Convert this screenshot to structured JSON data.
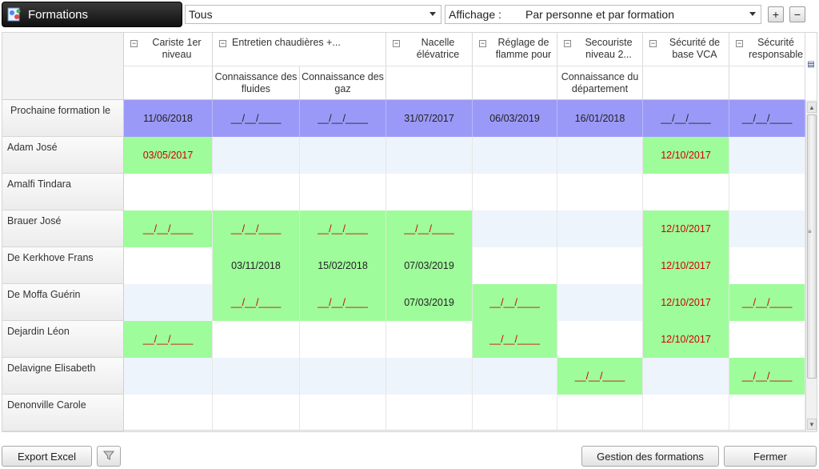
{
  "header": {
    "title": "Formations",
    "filter_value": "Tous",
    "view_label": "Affichage :",
    "view_value": "Par personne et par formation",
    "expand_label": "+",
    "collapse_label": "−"
  },
  "columns": [
    {
      "group": "Cariste 1er niveau",
      "sub": ""
    },
    {
      "group": "Entretien chaudières +...",
      "sub": "Connaissance des fluides"
    },
    {
      "group": "",
      "sub": "Connaissance des gaz"
    },
    {
      "group": "Nacelle élévatrice",
      "sub": ""
    },
    {
      "group": "Réglage de flamme pour",
      "sub": ""
    },
    {
      "group": "Secouriste niveau 2...",
      "sub": "Connaissance du département"
    },
    {
      "group": "Sécurité de base VCA",
      "sub": ""
    },
    {
      "group": "Sécurité responsable",
      "sub": ""
    }
  ],
  "next_training": {
    "label": "Prochaine formation le",
    "values": [
      "11/06/2018",
      "__/__/____",
      "__/__/____",
      "31/07/2017",
      "06/03/2019",
      "16/01/2018",
      "__/__/____",
      "__/__/____"
    ]
  },
  "rows": [
    {
      "name": "Adam José",
      "cells": [
        [
          "green",
          "03/05/2017",
          "red"
        ],
        [
          "alt",
          "",
          ""
        ],
        [
          "alt",
          "",
          ""
        ],
        [
          "alt",
          "",
          ""
        ],
        [
          "alt",
          "",
          ""
        ],
        [
          "alt",
          "",
          ""
        ],
        [
          "green",
          "12/10/2017",
          "red"
        ],
        [
          "alt",
          "",
          ""
        ]
      ]
    },
    {
      "name": "Amalfi Tindara",
      "cells": [
        [
          "white",
          "",
          ""
        ],
        [
          "white",
          "",
          ""
        ],
        [
          "white",
          "",
          ""
        ],
        [
          "white",
          "",
          ""
        ],
        [
          "white",
          "",
          ""
        ],
        [
          "white",
          "",
          ""
        ],
        [
          "white",
          "",
          ""
        ],
        [
          "white",
          "",
          ""
        ]
      ]
    },
    {
      "name": "Brauer José",
      "cells": [
        [
          "green",
          "__/__/____",
          "red"
        ],
        [
          "green",
          "__/__/____",
          "red"
        ],
        [
          "green",
          "__/__/____",
          "red"
        ],
        [
          "green",
          "__/__/____",
          "red"
        ],
        [
          "alt",
          "",
          ""
        ],
        [
          "alt",
          "",
          ""
        ],
        [
          "green",
          "12/10/2017",
          "red"
        ],
        [
          "alt",
          "",
          ""
        ]
      ]
    },
    {
      "name": "De Kerkhove Frans",
      "cells": [
        [
          "white",
          "",
          ""
        ],
        [
          "green",
          "03/11/2018",
          "dark"
        ],
        [
          "green",
          "15/02/2018",
          "dark"
        ],
        [
          "green",
          "07/03/2019",
          "dark"
        ],
        [
          "white",
          "",
          ""
        ],
        [
          "white",
          "",
          ""
        ],
        [
          "green",
          "12/10/2017",
          "red"
        ],
        [
          "white",
          "",
          ""
        ]
      ]
    },
    {
      "name": "De Moffa Guérin",
      "cells": [
        [
          "alt",
          "",
          ""
        ],
        [
          "green",
          "__/__/____",
          "red"
        ],
        [
          "green",
          "__/__/____",
          "red"
        ],
        [
          "green",
          "07/03/2019",
          "dark"
        ],
        [
          "green",
          "__/__/____",
          "red"
        ],
        [
          "alt",
          "",
          ""
        ],
        [
          "green",
          "12/10/2017",
          "red"
        ],
        [
          "green",
          "__/__/____",
          "red"
        ]
      ]
    },
    {
      "name": "Dejardin Léon",
      "cells": [
        [
          "green",
          "__/__/____",
          "red"
        ],
        [
          "white",
          "",
          ""
        ],
        [
          "white",
          "",
          ""
        ],
        [
          "white",
          "",
          ""
        ],
        [
          "green",
          "__/__/____",
          "red"
        ],
        [
          "white",
          "",
          ""
        ],
        [
          "green",
          "12/10/2017",
          "red"
        ],
        [
          "white",
          "",
          ""
        ]
      ]
    },
    {
      "name": "Delavigne Elisabeth",
      "cells": [
        [
          "alt",
          "",
          ""
        ],
        [
          "alt",
          "",
          ""
        ],
        [
          "alt",
          "",
          ""
        ],
        [
          "alt",
          "",
          ""
        ],
        [
          "alt",
          "",
          ""
        ],
        [
          "green",
          "__/__/____",
          "red"
        ],
        [
          "alt",
          "",
          ""
        ],
        [
          "green",
          "__/__/____",
          "red"
        ]
      ]
    },
    {
      "name": "Denonville Carole",
      "cells": [
        [
          "white",
          "",
          ""
        ],
        [
          "white",
          "",
          ""
        ],
        [
          "white",
          "",
          ""
        ],
        [
          "white",
          "",
          ""
        ],
        [
          "white",
          "",
          ""
        ],
        [
          "white",
          "",
          ""
        ],
        [
          "white",
          "",
          ""
        ],
        [
          "white",
          "",
          ""
        ]
      ]
    }
  ],
  "footer": {
    "export_label": "Export Excel",
    "gestion_label": "Gestion des formations",
    "close_label": "Fermer"
  },
  "icons": {
    "app": "formations-app-icon",
    "filter": "funnel-icon"
  },
  "colors": {
    "green": "#9efc9a",
    "blue": "#9b99f7",
    "red_text": "#d10000"
  }
}
